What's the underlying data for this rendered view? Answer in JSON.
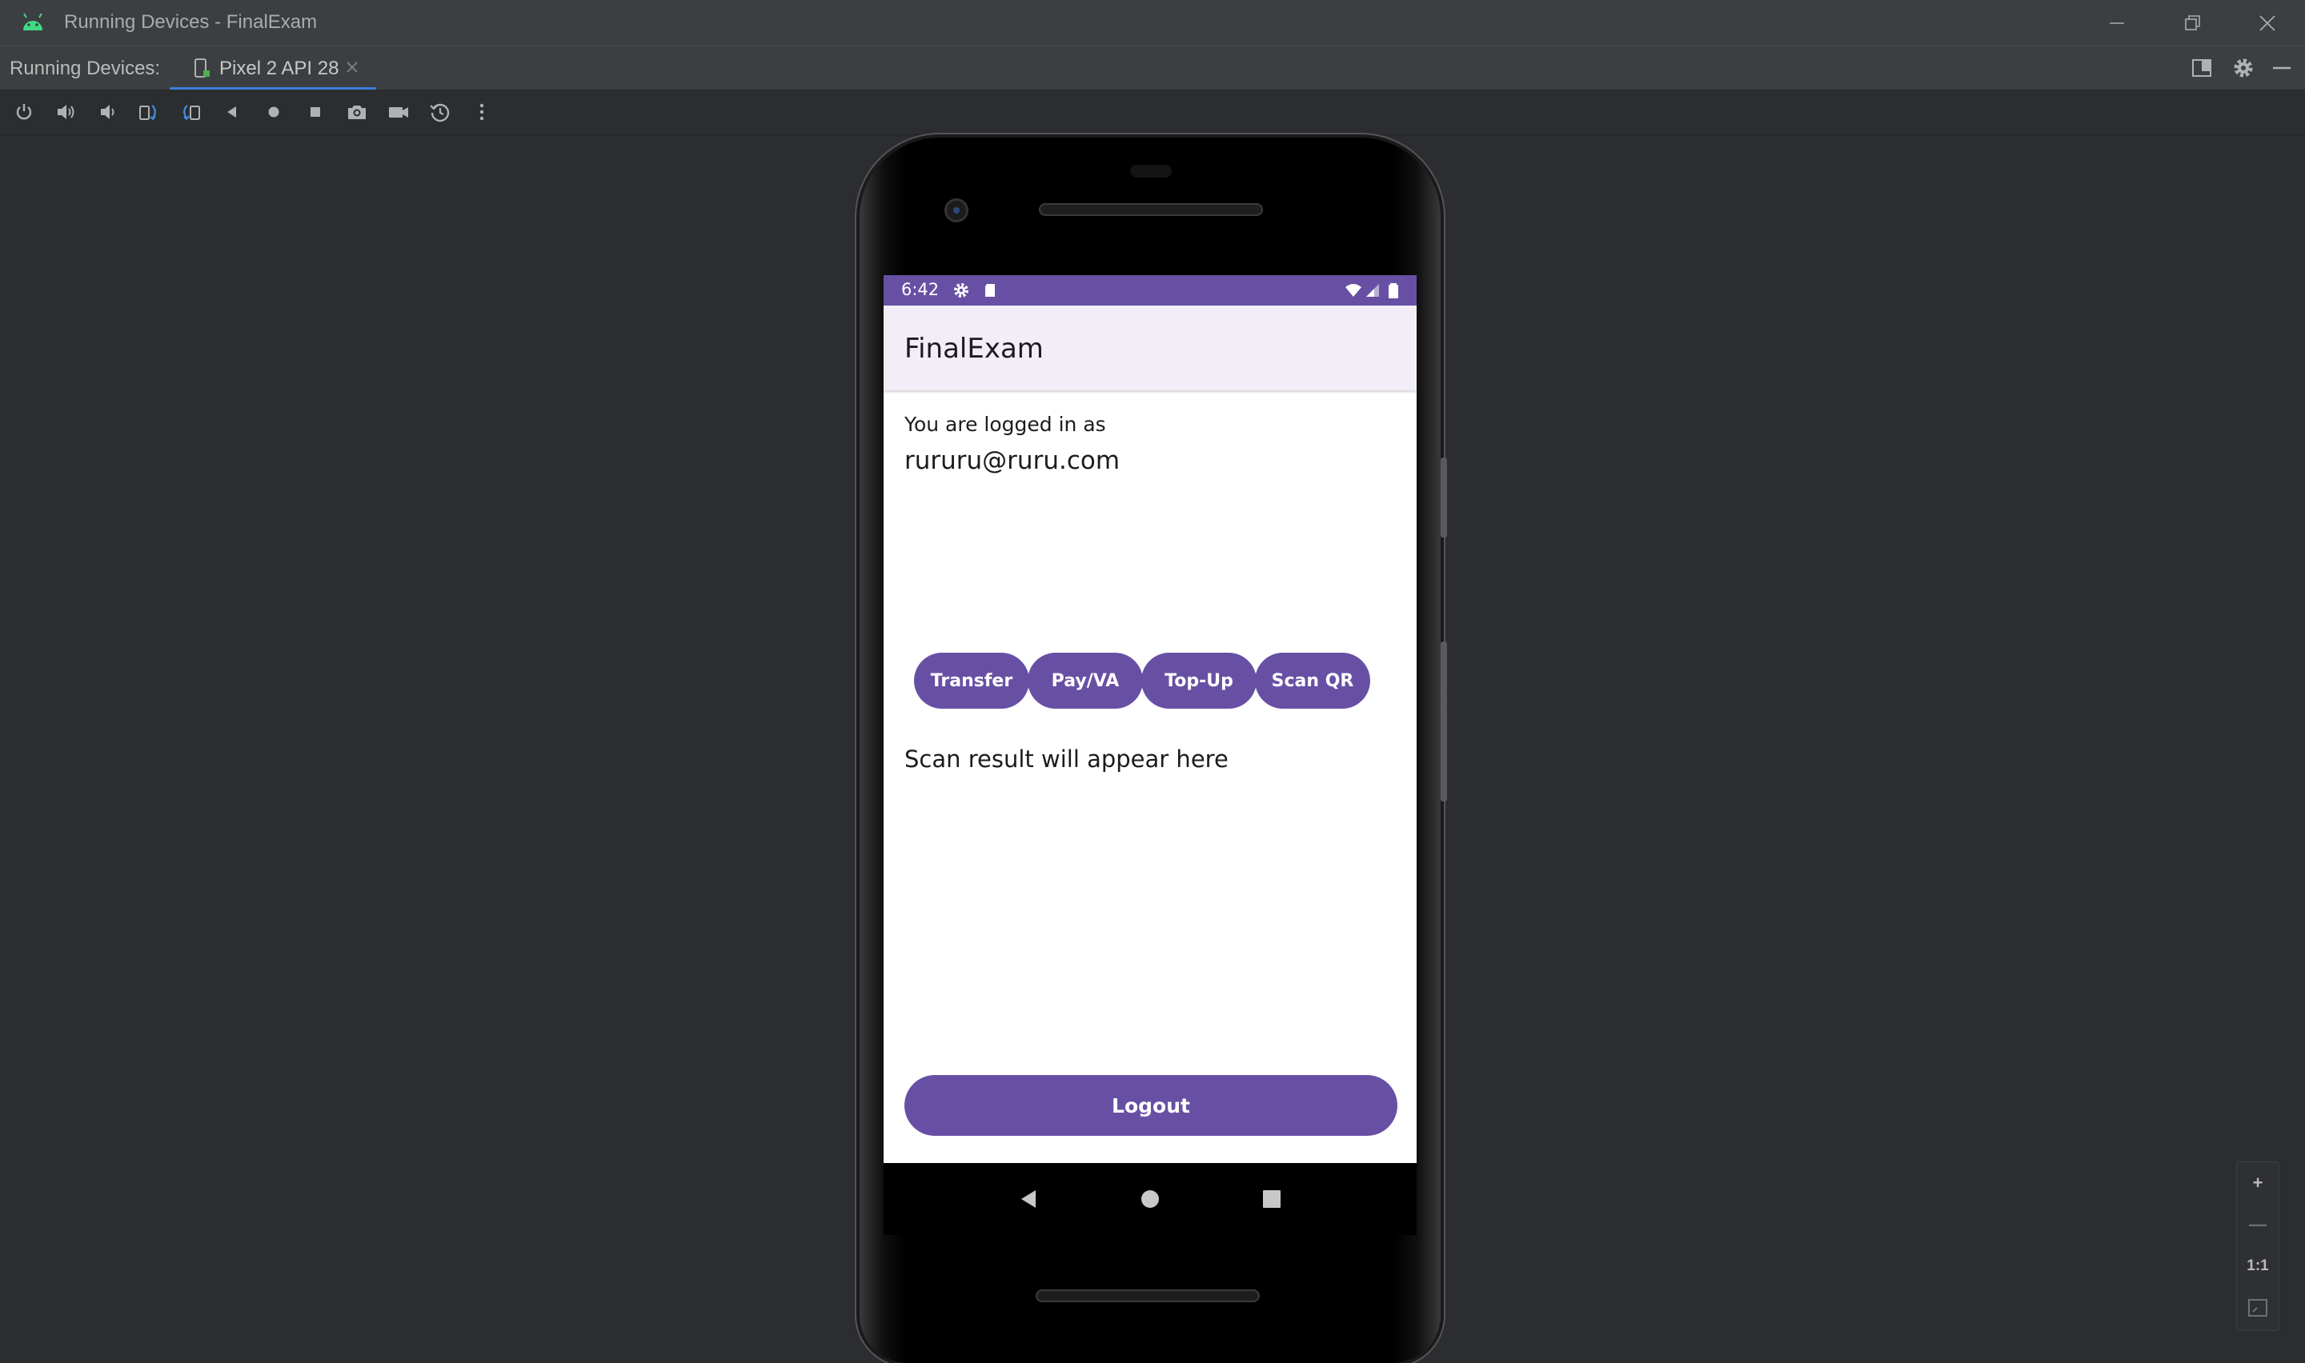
{
  "window": {
    "title": "Running Devices - FinalExam",
    "controls": [
      "minimize",
      "restore",
      "close"
    ]
  },
  "tabbar": {
    "label": "Running Devices:",
    "device_tab": "Pixel 2 API 28",
    "right_icons": [
      "layout-icon",
      "gear-icon",
      "hide-icon"
    ]
  },
  "toolbar": {
    "tools": [
      "power",
      "volume-up",
      "volume-down",
      "rotate-left",
      "rotate-right",
      "back",
      "home",
      "overview",
      "screenshot",
      "screen-record",
      "reset-rotation",
      "more"
    ]
  },
  "phone": {
    "status": {
      "time": "6:42"
    },
    "app_title": "FinalExam",
    "logged_label": "You are logged in as",
    "email": "rururu@ruru.com",
    "actions": [
      "Transfer",
      "Pay/VA",
      "Top-Up",
      "Scan QR"
    ],
    "scan_result": "Scan result will appear here",
    "logout": "Logout"
  },
  "zoom": {
    "plus": "+",
    "minus": "—",
    "actual": "1:1"
  },
  "colors": {
    "accent": "#6750a4",
    "appbar": "#f3edf7",
    "ide_bg": "#2b2d30",
    "tab_underline": "#3d7ddb"
  }
}
